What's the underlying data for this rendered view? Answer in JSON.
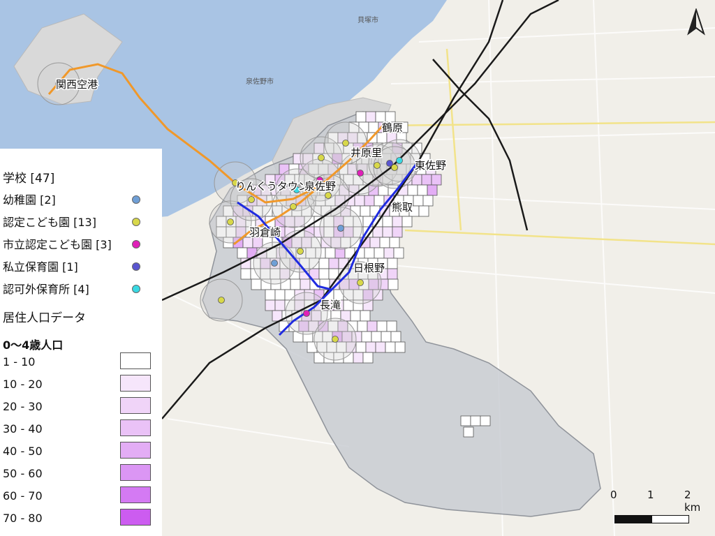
{
  "map": {
    "stations": [
      {
        "name": "関西空港"
      },
      {
        "name": "りんくうタウン"
      },
      {
        "name": "泉佐野"
      },
      {
        "name": "羽倉崎"
      },
      {
        "name": "井原里"
      },
      {
        "name": "鶴原"
      },
      {
        "name": "東佐野"
      },
      {
        "name": "熊取"
      },
      {
        "name": "日根野"
      },
      {
        "name": "長滝"
      }
    ],
    "base_labels": {
      "izumisano_city": "泉佐野市",
      "kaizuka_city": "貝塚市"
    },
    "colors": {
      "sea": "#a9c4e4",
      "land": "#f1efe9",
      "city_area": "#c9ccd2",
      "orange_line": "#f0982a",
      "blue_line": "#1f2be0",
      "black_line": "#1a1a1a"
    }
  },
  "legend": {
    "schools_title": "学校 [47]",
    "facilities": [
      {
        "label": "幼稚園 [2]",
        "color": "#6f9fd6"
      },
      {
        "label": "認定こども園 [13]",
        "color": "#d8d84a"
      },
      {
        "label": "市立認定こども園 [3]",
        "color": "#e020b8"
      },
      {
        "label": "私立保育園 [1]",
        "color": "#5a55d0"
      },
      {
        "label": "認可外保育所 [4]",
        "color": "#39d9e3"
      }
    ],
    "population_title": "居住人口データ",
    "population_sub": "0〜4歳人口",
    "classes": [
      {
        "label": "1 - 10",
        "color": "#ffffff"
      },
      {
        "label": "10 - 20",
        "color": "#f6e6fb"
      },
      {
        "label": "20 - 30",
        "color": "#f0d4f8"
      },
      {
        "label": "30 - 40",
        "color": "#eac2f7"
      },
      {
        "label": "40 - 50",
        "color": "#e3adf5"
      },
      {
        "label": "50 - 60",
        "color": "#db96f4"
      },
      {
        "label": "60 - 70",
        "color": "#d47af3"
      },
      {
        "label": "70 - 80",
        "color": "#cc5cf0"
      }
    ]
  },
  "scale": {
    "labels": [
      "0",
      "1",
      "2 km"
    ]
  }
}
